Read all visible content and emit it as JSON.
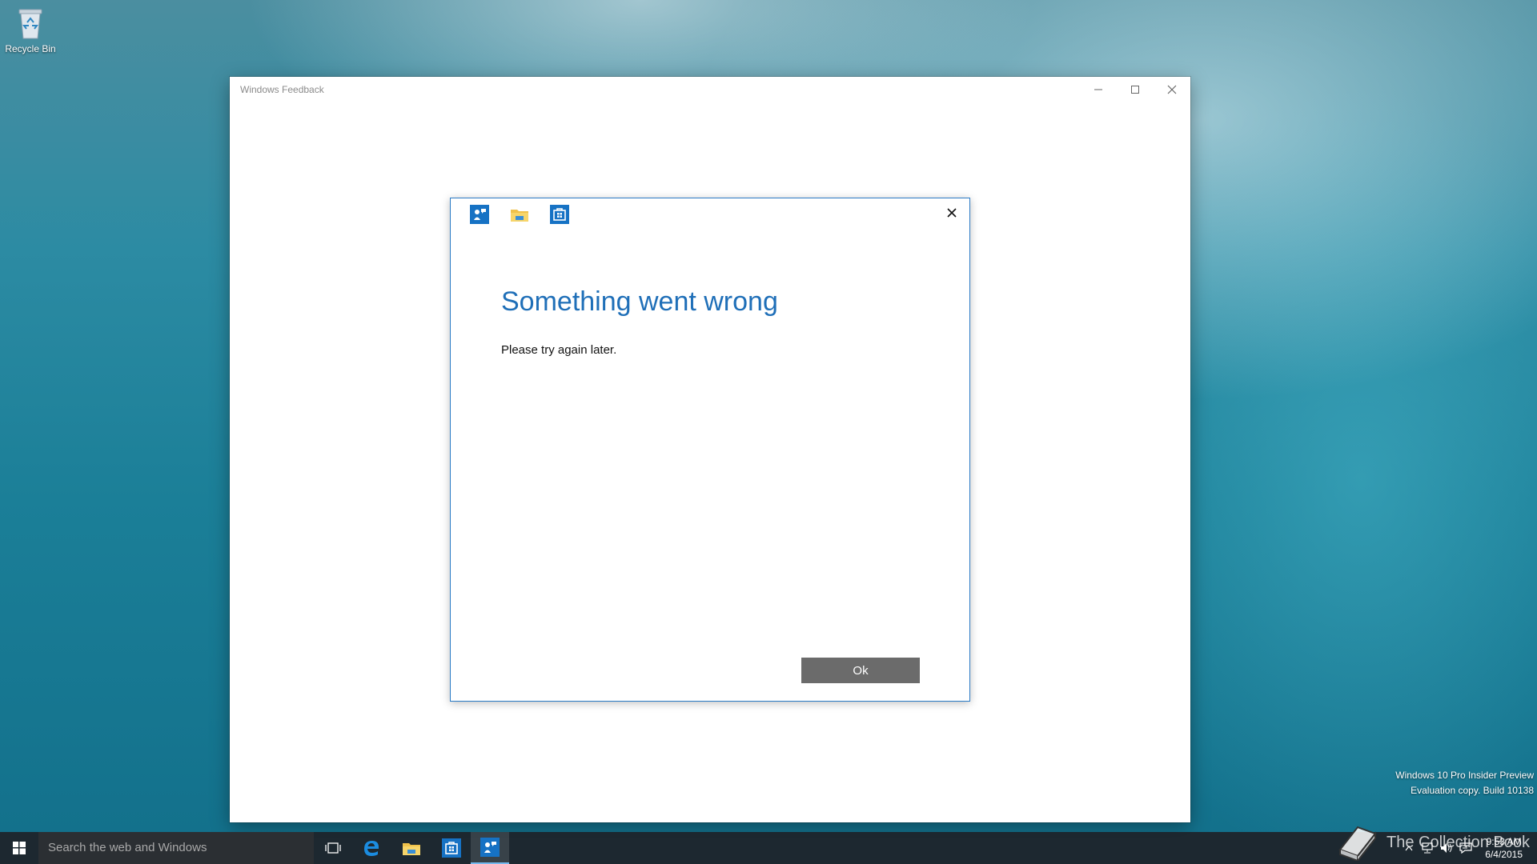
{
  "desktop": {
    "recycle_bin_label": "Recycle Bin"
  },
  "window": {
    "title": "Windows Feedback",
    "minimize_icon": "minimize-icon",
    "maximize_icon": "maximize-icon",
    "close_icon": "close-icon"
  },
  "dialog": {
    "icons": [
      "windows-feedback-icon",
      "file-explorer-icon",
      "store-icon"
    ],
    "title": "Something went wrong",
    "message": "Please try again later.",
    "ok_label": "Ok",
    "accent": "#1f6fb8"
  },
  "watermark": {
    "line1": "Windows 10 Pro Insider Preview",
    "line2": "Evaluation copy. Build 10138"
  },
  "overlay_brand": {
    "text": "The Collection Book"
  },
  "taskbar": {
    "search_placeholder": "Search the web and Windows",
    "pinned": [
      "task-view-icon",
      "edge-icon",
      "file-explorer-icon",
      "store-icon",
      "windows-feedback-icon"
    ],
    "active": "windows-feedback-icon",
    "clock_time": "9:53 AM",
    "clock_date": "6/4/2015"
  }
}
